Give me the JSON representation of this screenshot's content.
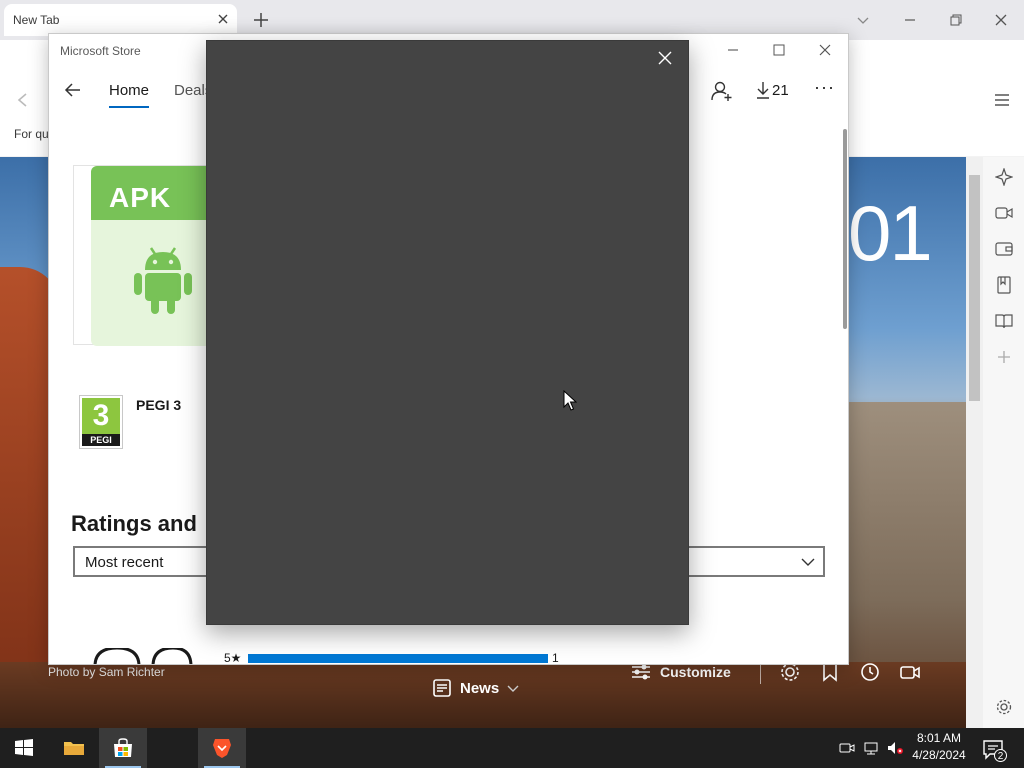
{
  "browser": {
    "tab_title": "New Tab",
    "quick_link_text": "For qu",
    "background": {
      "clock_fragment": "01",
      "photo_credit": "Photo by Sam Richter",
      "news_label": "News",
      "customize_label": "Customize"
    },
    "accent": "#fb542b"
  },
  "store": {
    "window_title": "Microsoft Store",
    "nav": {
      "home_label": "Home",
      "deals_label": "Deals"
    },
    "downloads_count": "21",
    "more_label": "···",
    "app_icon_label": "APK",
    "age_rating": {
      "badge_number": "3",
      "badge_text": "PEGI",
      "label": "PEGI 3"
    },
    "ratings_heading": "Ratings and",
    "sort": {
      "selected": "Most recent"
    },
    "ratings": [
      {
        "stars_label": "5★",
        "count": "1",
        "fraction": 1.0
      }
    ],
    "accent": "#0067c0"
  },
  "modal": {
    "background": "#444444"
  },
  "taskbar": {
    "time": "8:01 AM",
    "date": "4/28/2024",
    "notification_count": "2"
  }
}
